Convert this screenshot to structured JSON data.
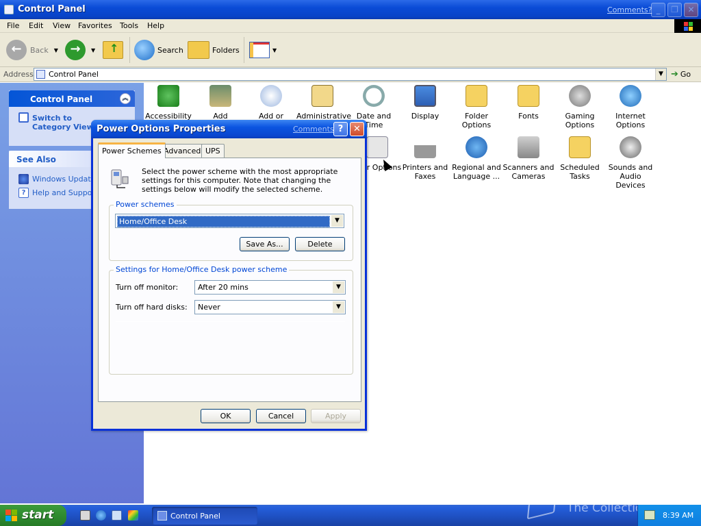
{
  "window": {
    "title": "Control Panel",
    "comments_link": "Comments?",
    "menu": [
      "File",
      "Edit",
      "View",
      "Favorites",
      "Tools",
      "Help"
    ]
  },
  "toolbar": {
    "back_label": "Back",
    "search_label": "Search",
    "folders_label": "Folders"
  },
  "address": {
    "label": "Address",
    "value": "Control Panel",
    "go_label": "Go"
  },
  "sidebar": {
    "control_panel": {
      "title": "Control Panel",
      "switch_link": "Switch to Category View"
    },
    "see_also": {
      "title": "See Also",
      "items": [
        "Windows Update",
        "Help and Support"
      ]
    }
  },
  "items": [
    {
      "label": "Accessibility",
      "icon": "accessibility-icon"
    },
    {
      "label": "Add Hardware",
      "icon": "add-hardware-icon"
    },
    {
      "label": "Add or",
      "icon": "add-remove-programs-icon"
    },
    {
      "label": "Administrative",
      "icon": "administrative-tools-icon"
    },
    {
      "label": "Date and Time",
      "icon": "date-time-icon"
    },
    {
      "label": "Display",
      "icon": "display-icon"
    },
    {
      "label": "Folder Options",
      "icon": "folder-options-icon"
    },
    {
      "label": "Fonts",
      "icon": "fonts-icon"
    },
    {
      "label": "Gaming Options",
      "icon": "gaming-options-icon"
    },
    {
      "label": "Internet Options",
      "icon": "internet-options-icon"
    },
    {
      "label": "er Options",
      "icon": "power-options-icon"
    },
    {
      "label": "Printers and Faxes",
      "icon": "printers-faxes-icon"
    },
    {
      "label": "Regional and Language ...",
      "icon": "regional-language-icon"
    },
    {
      "label": "Scanners and Cameras",
      "icon": "scanners-cameras-icon"
    },
    {
      "label": "Scheduled Tasks",
      "icon": "scheduled-tasks-icon"
    },
    {
      "label": "Sounds and Audio Devices",
      "icon": "sounds-audio-icon"
    }
  ],
  "dialog": {
    "title": "Power Options Properties",
    "comments_link": "Comments?",
    "help_glyph": "?",
    "close_glyph": "✕",
    "tabs": [
      "Power Schemes",
      "Advanced",
      "UPS"
    ],
    "intro": "Select the power scheme with the most appropriate settings for this computer. Note that changing the settings below will modify the selected scheme.",
    "schemes_group": {
      "legend": "Power schemes",
      "selected": "Home/Office Desk",
      "save_as": "Save As...",
      "delete": "Delete"
    },
    "settings_group": {
      "legend": "Settings for Home/Office Desk power scheme",
      "monitor_label": "Turn off monitor:",
      "monitor_value": "After 20 mins",
      "disks_label": "Turn off hard disks:",
      "disks_value": "Never"
    },
    "buttons": {
      "ok": "OK",
      "cancel": "Cancel",
      "apply": "Apply"
    }
  },
  "taskbar": {
    "start_label": "start",
    "task_label": "Control Panel",
    "clock": "8:39 AM",
    "watermark": "The Collection Book"
  }
}
